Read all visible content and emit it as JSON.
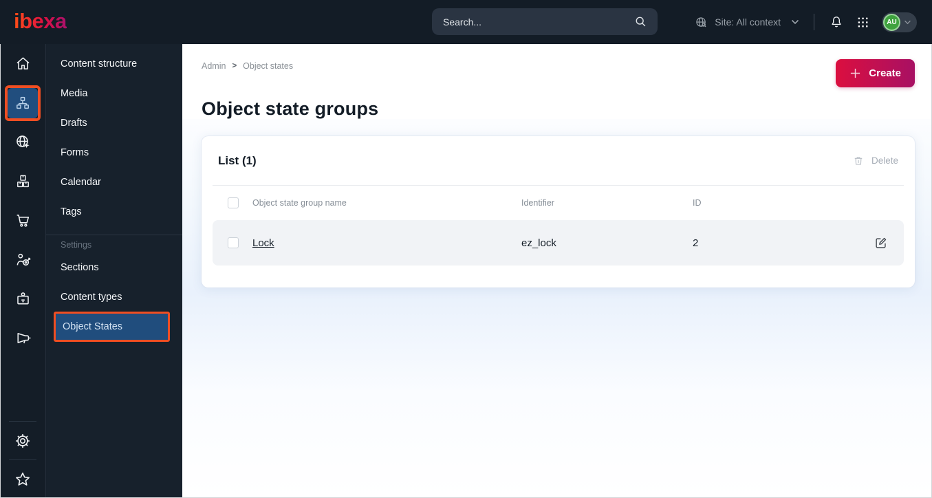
{
  "topbar": {
    "logo_text": "ibexa",
    "search_placeholder": "Search...",
    "site_label": "Site: All context",
    "avatar_initials": "AU"
  },
  "menu": {
    "items": [
      {
        "label": "Content structure"
      },
      {
        "label": "Media"
      },
      {
        "label": "Drafts"
      },
      {
        "label": "Forms"
      },
      {
        "label": "Calendar"
      },
      {
        "label": "Tags"
      }
    ],
    "section_label": "Settings",
    "settings_items": [
      {
        "label": "Sections"
      },
      {
        "label": "Content types"
      },
      {
        "label": "Object States",
        "active": true
      }
    ]
  },
  "main": {
    "breadcrumb": {
      "crumbs": [
        "Admin",
        "Object states"
      ],
      "separator": ">"
    },
    "create_label": "Create",
    "title": "Object state groups",
    "list": {
      "header": "List (1)",
      "delete_label": "Delete",
      "columns": [
        "Object state group name",
        "Identifier",
        "ID"
      ],
      "rows": [
        {
          "name": "Lock",
          "identifier": "ez_lock",
          "id": "2"
        }
      ]
    }
  },
  "colors": {
    "topbar_dark": "#131c26",
    "annotation_orange": "#ef4e22",
    "active_blue": "#214e7e",
    "create_gradient_start": "#db0f3f",
    "create_gradient_end": "#a81063",
    "avatar_green": "#3fa23f",
    "row_background": "#f1f3f6"
  }
}
